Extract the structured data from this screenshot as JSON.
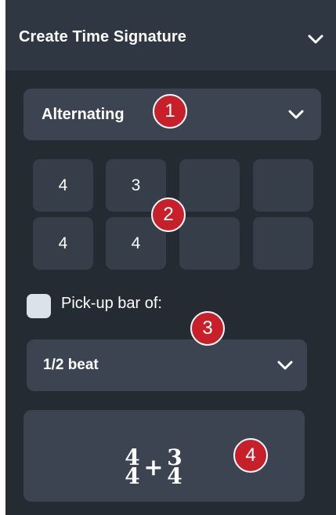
{
  "panel": {
    "title": "Create Time Signature",
    "chevron_icon": "chevron-down-icon"
  },
  "type_dropdown": {
    "selected": "Alternating",
    "chevron_icon": "chevron-down-icon"
  },
  "grid": {
    "numerators": [
      "4",
      "3",
      "",
      ""
    ],
    "denominators": [
      "4",
      "4",
      "",
      ""
    ]
  },
  "pickup": {
    "checked": false,
    "label": "Pick-up bar of:"
  },
  "pickup_dropdown": {
    "selected": "1/2 beat",
    "chevron_icon": "chevron-down-icon"
  },
  "preview": {
    "first_numerator": "4",
    "first_denominator": "4",
    "operator": "+",
    "second_numerator": "3",
    "second_denominator": "4"
  },
  "callouts": [
    "1",
    "2",
    "3",
    "4"
  ],
  "colors": {
    "panel_bg": "#242b33",
    "header_bg": "#2f3742",
    "control_bg": "#3b4450",
    "cell_bg": "#353e49",
    "callout_red": "#c8202a"
  }
}
